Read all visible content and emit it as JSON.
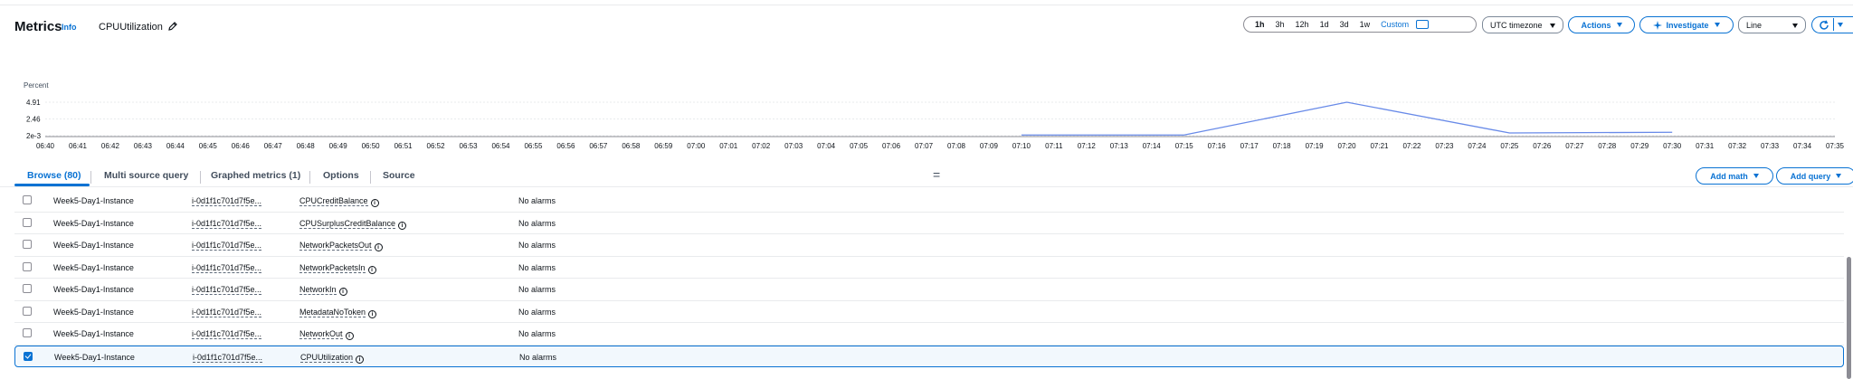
{
  "header": {
    "title": "Metrics",
    "info": "Info",
    "metric_name": "CPUUtilization",
    "ranges": [
      "1h",
      "3h",
      "12h",
      "1d",
      "3d",
      "1w"
    ],
    "custom": "Custom",
    "timezone": "UTC timezone",
    "actions": "Actions",
    "investigate": "Investigate",
    "chart_type": "Line"
  },
  "chart_data": {
    "type": "line",
    "ylabel": "Percent",
    "y_ticks": [
      "4.91",
      "2.46",
      "2e-3"
    ],
    "x_ticks": [
      "06:40",
      "06:41",
      "06:42",
      "06:43",
      "06:44",
      "06:45",
      "06:46",
      "06:47",
      "06:48",
      "06:49",
      "06:50",
      "06:51",
      "06:52",
      "06:53",
      "06:54",
      "06:55",
      "06:56",
      "06:57",
      "06:58",
      "06:59",
      "07:00",
      "07:01",
      "07:02",
      "07:03",
      "07:04",
      "07:05",
      "07:06",
      "07:07",
      "07:08",
      "07:09",
      "07:10",
      "07:11",
      "07:12",
      "07:13",
      "07:14",
      "07:15",
      "07:16",
      "07:17",
      "07:18",
      "07:19",
      "07:20",
      "07:21",
      "07:22",
      "07:23",
      "07:24",
      "07:25",
      "07:26",
      "07:27",
      "07:28",
      "07:29",
      "07:30",
      "07:31",
      "07:32",
      "07:33",
      "07:34",
      "07:35"
    ],
    "series": [
      {
        "x": [
          "07:10",
          "07:15",
          "07:20",
          "07:25",
          "07:30"
        ],
        "values": [
          0.1,
          0.1,
          4.91,
          0.4,
          0.5
        ]
      }
    ],
    "ylim": [
      0.002,
      4.91
    ],
    "color": "#688ae8"
  },
  "tabs": {
    "browse": "Browse (80)",
    "multi": "Multi source query",
    "graphed": "Graphed metrics (1)",
    "options": "Options",
    "source": "Source",
    "add_math": "Add math",
    "add_query": "Add query"
  },
  "rows": [
    {
      "instance": "Week5-Day1-Instance",
      "id": "i-0d1f1c701d7f5e...",
      "metric": "CPUCreditBalance",
      "alarms": "No alarms",
      "checked": false
    },
    {
      "instance": "Week5-Day1-Instance",
      "id": "i-0d1f1c701d7f5e...",
      "metric": "CPUSurplusCreditBalance",
      "alarms": "No alarms",
      "checked": false
    },
    {
      "instance": "Week5-Day1-Instance",
      "id": "i-0d1f1c701d7f5e...",
      "metric": "NetworkPacketsOut",
      "alarms": "No alarms",
      "checked": false
    },
    {
      "instance": "Week5-Day1-Instance",
      "id": "i-0d1f1c701d7f5e...",
      "metric": "NetworkPacketsIn",
      "alarms": "No alarms",
      "checked": false
    },
    {
      "instance": "Week5-Day1-Instance",
      "id": "i-0d1f1c701d7f5e...",
      "metric": "NetworkIn",
      "alarms": "No alarms",
      "checked": false
    },
    {
      "instance": "Week5-Day1-Instance",
      "id": "i-0d1f1c701d7f5e...",
      "metric": "MetadataNoToken",
      "alarms": "No alarms",
      "checked": false
    },
    {
      "instance": "Week5-Day1-Instance",
      "id": "i-0d1f1c701d7f5e...",
      "metric": "NetworkOut",
      "alarms": "No alarms",
      "checked": false
    },
    {
      "instance": "Week5-Day1-Instance",
      "id": "i-0d1f1c701d7f5e...",
      "metric": "CPUUtilization",
      "alarms": "No alarms",
      "checked": true
    }
  ]
}
